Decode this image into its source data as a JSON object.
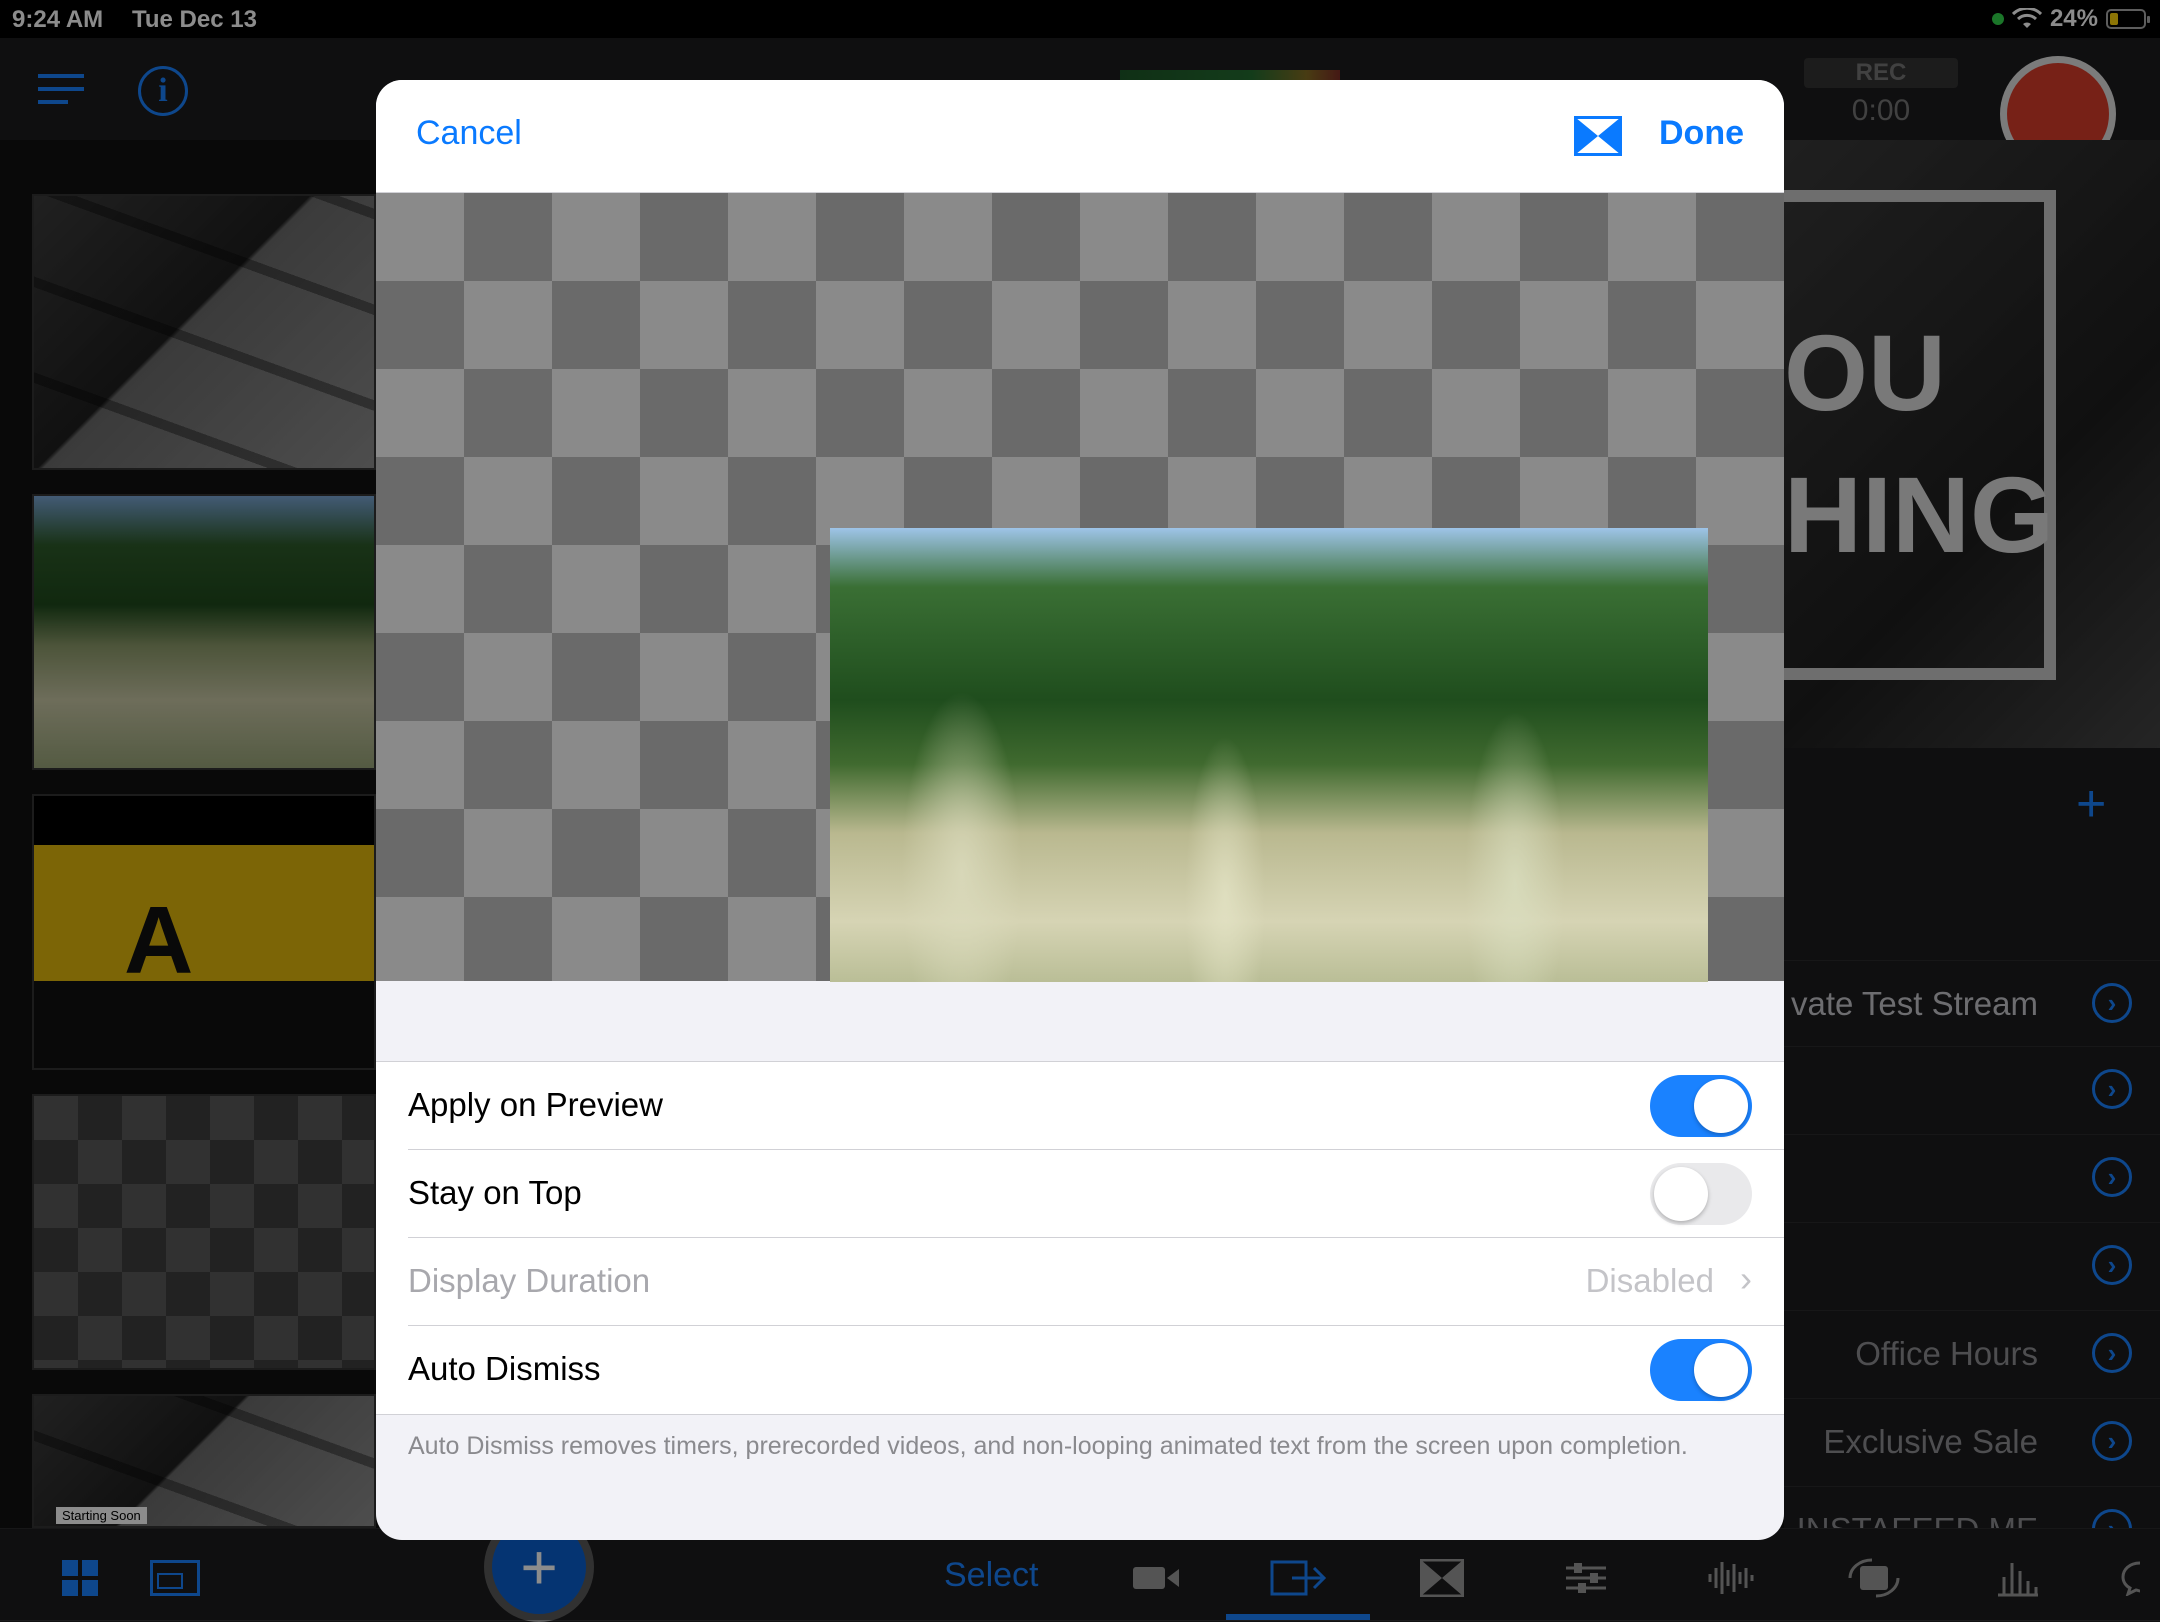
{
  "status_bar": {
    "time": "9:24 AM",
    "date": "Tue Dec 13",
    "battery": "24%"
  },
  "top_bar": {
    "rec_label": "REC",
    "rec_time": "0:00"
  },
  "thumbnails": {
    "letter": "A",
    "caption": "Starting Soon"
  },
  "right_panel": {
    "preview_text_1": "OU",
    "preview_text_2": "HING",
    "rows": [
      "vate Test Stream",
      "",
      "",
      "",
      "Office Hours",
      "Exclusive Sale",
      "INSTAFEED ME"
    ]
  },
  "modal": {
    "cancel_label": "Cancel",
    "done_label": "Done",
    "settings": {
      "apply_on_preview": {
        "label": "Apply on Preview",
        "on": true
      },
      "stay_on_top": {
        "label": "Stay on Top",
        "on": false
      },
      "display_duration": {
        "label": "Display Duration",
        "value": "Disabled"
      },
      "auto_dismiss": {
        "label": "Auto Dismiss",
        "on": true
      }
    },
    "footer_note": "Auto Dismiss removes timers, prerecorded videos, and non-looping animated text from the screen upon completion."
  },
  "bottom_bar": {
    "select_label": "Select"
  },
  "colors": {
    "accent": "#1a82ff",
    "record": "#d93d2b",
    "toggle_on": "#1a82ff"
  }
}
